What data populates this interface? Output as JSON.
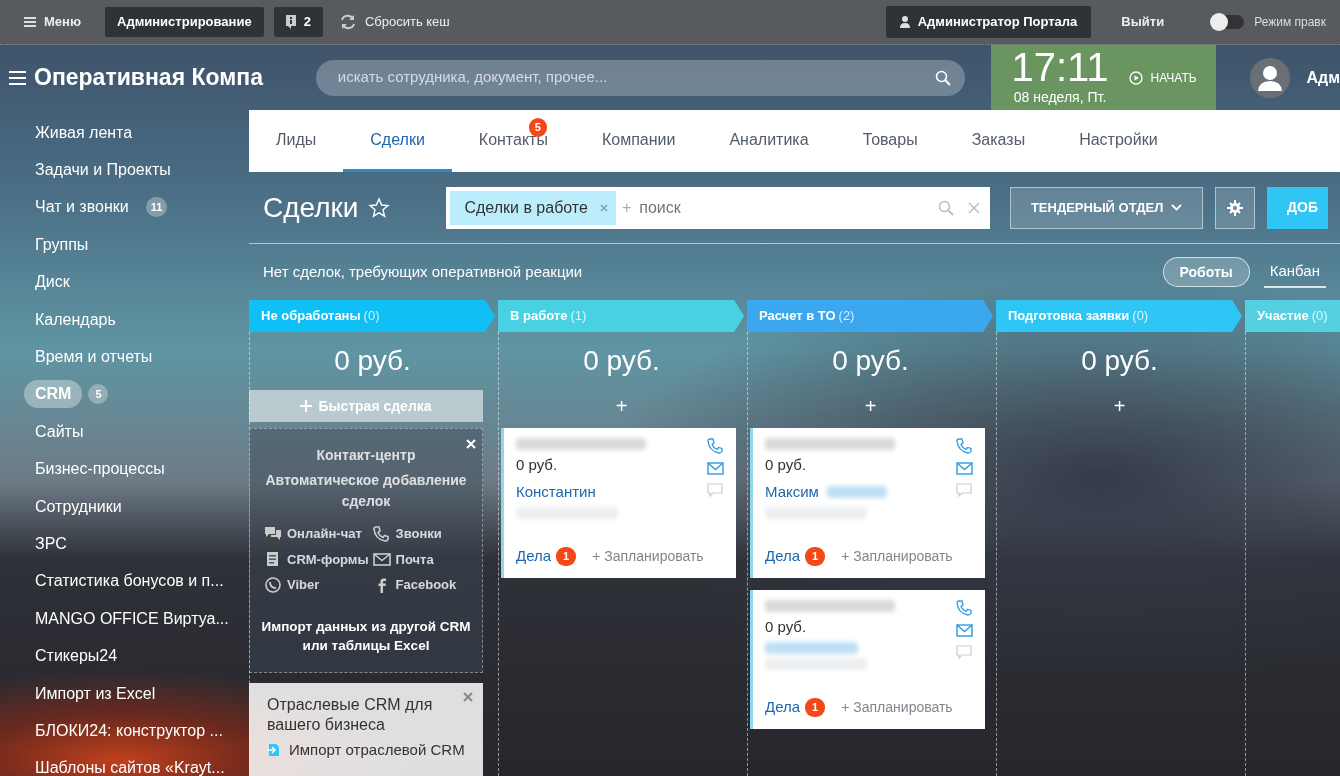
{
  "topbar": {
    "menu": "Меню",
    "admin": "Администрирование",
    "notices": "2",
    "reset_cache": "Сбросить кеш",
    "user": "Администратор Портала",
    "logout": "Выйти",
    "edit_mode": {
      "label": "Режим правк",
      "on": false
    }
  },
  "header": {
    "portal_title": "Оперативная Компа",
    "search": {
      "placeholder": "искать сотрудника, документ, прочее..."
    },
    "clock": {
      "time": "17:11",
      "date": "08 неделя, Пт.",
      "start": "НАЧАТЬ"
    },
    "user_short": "Адм"
  },
  "sidebar": {
    "items": [
      {
        "label": "Живая лента",
        "selected": false
      },
      {
        "label": "Задачи и Проекты",
        "selected": false
      },
      {
        "label": "Чат и звонки",
        "count": "11",
        "selected": false
      },
      {
        "label": "Группы",
        "selected": false
      },
      {
        "label": "Диск",
        "selected": false
      },
      {
        "label": "Календарь",
        "selected": false
      },
      {
        "label": "Время и отчеты",
        "selected": false
      },
      {
        "label": "CRM",
        "count": "5",
        "selected": true
      },
      {
        "label": "Сайты",
        "selected": false
      },
      {
        "label": "Бизнес-процессы",
        "selected": false
      },
      {
        "label": "Сотрудники",
        "selected": false
      },
      {
        "label": "ЗРС",
        "selected": false
      },
      {
        "label": "Статистика бонусов и п...",
        "selected": false
      },
      {
        "label": "MANGO OFFICE Виртуа...",
        "selected": false
      },
      {
        "label": "Стикеры24",
        "selected": false
      },
      {
        "label": "Импорт из Excel",
        "selected": false
      },
      {
        "label": "БЛОКИ24: конструктор ...",
        "selected": false
      },
      {
        "label": "Шаблоны сайтов «Krayt...",
        "selected": false
      }
    ]
  },
  "tabs": [
    {
      "label": "Лиды",
      "selected": false
    },
    {
      "label": "Сделки",
      "selected": true
    },
    {
      "label": "Контакты",
      "count": "5",
      "selected": false
    },
    {
      "label": "Компании",
      "selected": false
    },
    {
      "label": "Аналитика",
      "selected": false
    },
    {
      "label": "Товары",
      "selected": false
    },
    {
      "label": "Заказы",
      "selected": false
    },
    {
      "label": "Настройки",
      "selected": false
    }
  ],
  "toolbar": {
    "title": "Сделки",
    "filter_chip": "Сделки в работе",
    "search": {
      "placeholder": "поиск"
    },
    "add_prefix": "+",
    "category": "ТЕНДЕРНЫЙ ОТДЕЛ",
    "add_button": "ДОБ"
  },
  "notice": "Нет сделок, требующих оперативной реакции",
  "robots": "Роботы",
  "view": {
    "label": "Канбан",
    "selected": true
  },
  "columns": [
    {
      "title": "Не обработаны",
      "count": "(0)",
      "color": "#0fbff5",
      "total": "0 руб.",
      "quick_deal": "Быстрая сделка"
    },
    {
      "title": "В работе",
      "count": "(1)",
      "color": "#47d1e2",
      "total": "0 руб.",
      "add": "+",
      "cards": [
        {
          "price": "0 руб.",
          "contact": "Константин",
          "activity": "Дела",
          "activity_count": "1",
          "plan": "+ Запланировать"
        }
      ]
    },
    {
      "title": "Расчет в ТО",
      "count": "(2)",
      "color": "#3aa7ee",
      "total": "0 руб.",
      "add": "+",
      "cards": [
        {
          "price": "0 руб.",
          "contact": "Максим",
          "activity": "Дела",
          "activity_count": "1",
          "plan": "+ Запланировать"
        },
        {
          "price": "0 руб.",
          "activity": "Дела",
          "activity_count": "1",
          "plan": "+ Запланировать"
        }
      ]
    },
    {
      "title": "Подготовка заявки",
      "count": "(0)",
      "color": "#2fc6f6",
      "total": "0 руб.",
      "add": "+"
    },
    {
      "title": "Участие",
      "count": "(0)",
      "color": "#55d0e0"
    }
  ],
  "contact_center": {
    "title": "Контакт-центр",
    "subtitle": "Автоматическое добавление сделок",
    "channels": [
      "Онлайн-чат",
      "Звонки",
      "CRM-формы",
      "Почта",
      "Viber",
      "Facebook"
    ],
    "import_before": "Импорт данных из ",
    "import_link_1": "другой CRM",
    "import_middle": " или ",
    "import_link_2": "таблицы Excel"
  },
  "industry": {
    "title": "Отраслевые CRM для вашего бизнеса",
    "link": "Импорт отраслевой CRM"
  }
}
